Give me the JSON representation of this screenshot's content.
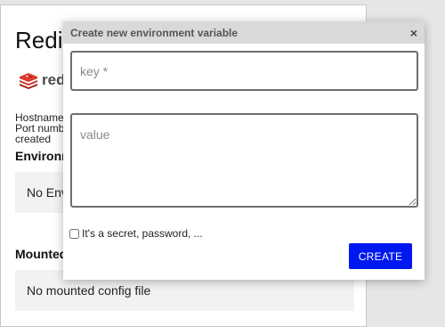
{
  "background": {
    "title": "Redis",
    "logo_text": "redis",
    "info_lines": [
      "Hostname",
      "Port numb",
      "created"
    ],
    "environment_heading": "Environm",
    "environment_empty": "No Envi",
    "mounted_heading": "Mounted",
    "mounted_empty": "No mounted config file"
  },
  "modal": {
    "title": "Create new environment variable",
    "close_label": "×",
    "key_placeholder": "key *",
    "value_placeholder": "value",
    "secret_label": "It's a secret, password, ...",
    "secret_checked": false,
    "create_label": "CREATE"
  },
  "colors": {
    "accent": "#0018f0",
    "redis_red": "#d82c20"
  }
}
